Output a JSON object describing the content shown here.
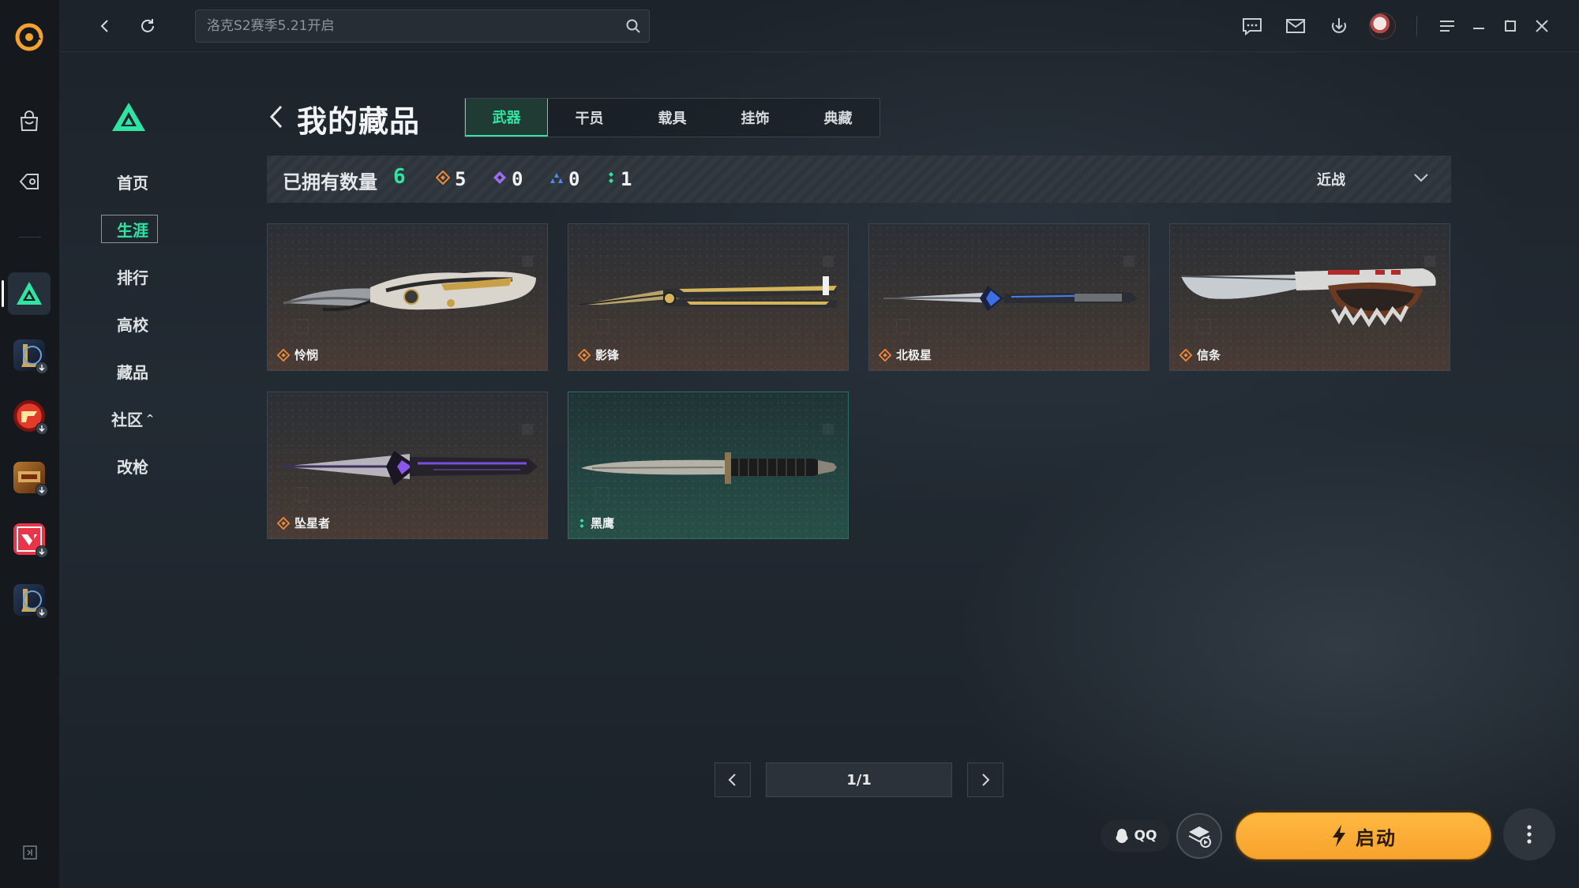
{
  "topbar": {
    "search_placeholder": "洛克S2赛季5.21开启"
  },
  "sidebar": {
    "items": [
      {
        "label": "首页"
      },
      {
        "label": "生涯"
      },
      {
        "label": "排行"
      },
      {
        "label": "高校"
      },
      {
        "label": "藏品"
      },
      {
        "label": "社区"
      },
      {
        "label": "改枪"
      }
    ],
    "community_caret": "^"
  },
  "header": {
    "title": "我的藏品",
    "tabs": [
      {
        "label": "武器"
      },
      {
        "label": "干员"
      },
      {
        "label": "载具"
      },
      {
        "label": "挂饰"
      },
      {
        "label": "典藏"
      }
    ]
  },
  "stats": {
    "owned_label": "已拥有数量",
    "owned_total": "6",
    "rarity_counts": [
      {
        "color": "#f08a3c",
        "count": "5"
      },
      {
        "color": "#9b6cf0",
        "count": "0"
      },
      {
        "color": "#4e8df0",
        "count": "0"
      },
      {
        "color": "#2fe5a4",
        "count": "1"
      }
    ],
    "filter_value": "近战"
  },
  "items": [
    {
      "name": "怜悯",
      "rarity_color": "#f08a3c",
      "icon": "knife-icon"
    },
    {
      "name": "影锋",
      "rarity_color": "#f08a3c",
      "icon": "butterfly-knife-icon"
    },
    {
      "name": "北极星",
      "rarity_color": "#f08a3c",
      "icon": "dagger-icon"
    },
    {
      "name": "信条",
      "rarity_color": "#f08a3c",
      "icon": "knuckle-knife-icon"
    },
    {
      "name": "坠星者",
      "rarity_color": "#f08a3c",
      "icon": "blade-icon"
    },
    {
      "name": "黑鹰",
      "rarity_color": "#2fe5a4",
      "icon": "combat-knife-icon"
    }
  ],
  "pagination": {
    "label": "1/1"
  },
  "bottom": {
    "qq_label": "QQ",
    "launch_label": "启动"
  },
  "colors": {
    "accent": "#2fe5a4",
    "launch": "#f7a22c"
  }
}
